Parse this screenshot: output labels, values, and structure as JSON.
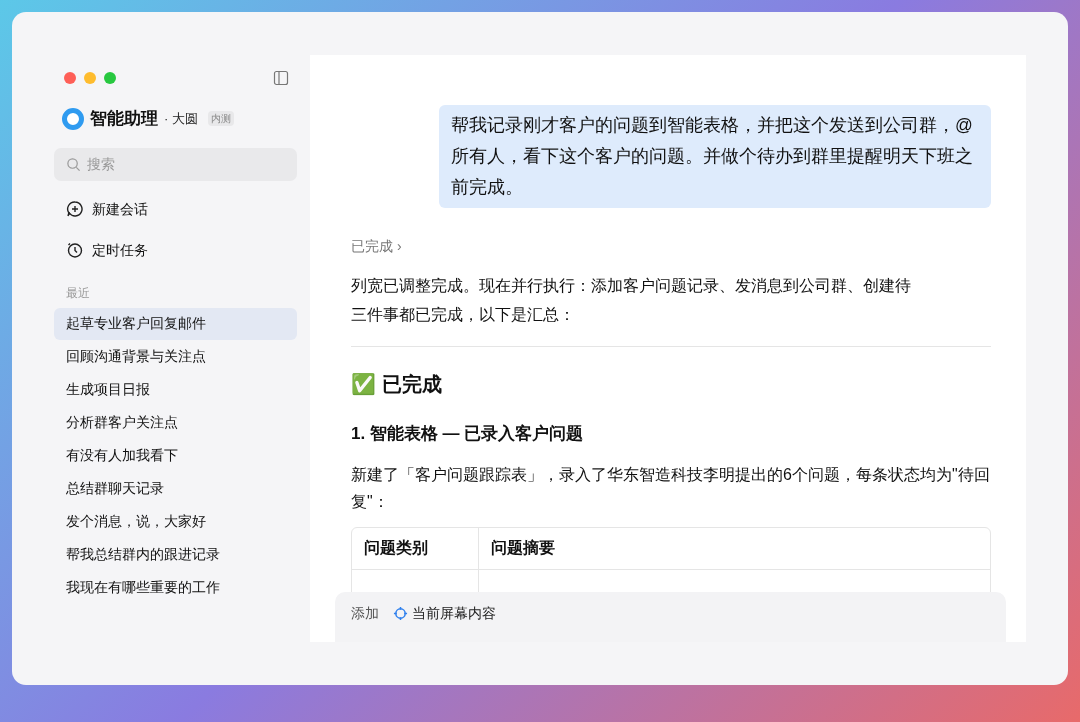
{
  "app": {
    "name": "智能助理",
    "user": "· 大圆",
    "badge": "内测"
  },
  "search": {
    "placeholder": "搜索"
  },
  "actions": [
    {
      "kind": "new-chat",
      "label": "新建会话"
    },
    {
      "kind": "scheduled",
      "label": "定时任务"
    }
  ],
  "recent": {
    "heading": "最近",
    "items": [
      {
        "label": "起草专业客户回复邮件",
        "selected": true
      },
      {
        "label": "回顾沟通背景与关注点",
        "selected": false
      },
      {
        "label": "生成项目日报",
        "selected": false
      },
      {
        "label": "分析群客户关注点",
        "selected": false
      },
      {
        "label": "有没有人加我看下",
        "selected": false
      },
      {
        "label": "总结群聊天记录",
        "selected": false
      },
      {
        "label": "发个消息，说，大家好",
        "selected": false
      },
      {
        "label": "帮我总结群内的跟进记录",
        "selected": false
      },
      {
        "label": "我现在有哪些重要的工作",
        "selected": false
      }
    ]
  },
  "user_message": "帮我记录刚才客户的问题到智能表格，并把这个发送到公司群，@所有人，看下这个客户的问题。并做个待办到群里提醒明天下班之前完成。",
  "reply": {
    "status": "已完成 ›",
    "intro": "列宽已调整完成。现在并行执行：添加客户问题记录、发消息到公司群、创建待",
    "intro_2": "三件事都已完成，以下是汇总：",
    "heading": "✅ 已完成",
    "section": "1.  智能表格 — 已录入客户问题",
    "section_text": "新建了「客户问题跟踪表」，录入了华东智造科技李明提出的6个问题，每条状态均为\"待回复\"：",
    "table": {
      "columns": [
        "问题类别",
        "问题摘要"
      ]
    }
  },
  "composer": {
    "add_label": "添加",
    "context": "当前屏幕内容"
  }
}
